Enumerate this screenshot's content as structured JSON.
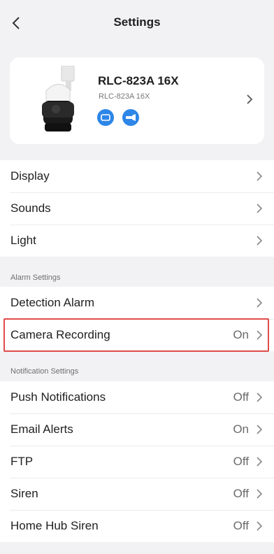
{
  "header": {
    "title": "Settings"
  },
  "device": {
    "name": "RLC-823A 16X",
    "model": "RLC-823A 16X",
    "badges": [
      "camera-badge-icon",
      "spotlight-badge-icon"
    ],
    "accent_color": "#2d86e8"
  },
  "general": {
    "items": [
      {
        "label": "Display",
        "value": ""
      },
      {
        "label": "Sounds",
        "value": ""
      },
      {
        "label": "Light",
        "value": ""
      }
    ]
  },
  "alarm": {
    "header": "Alarm Settings",
    "items": [
      {
        "label": "Detection Alarm",
        "value": ""
      },
      {
        "label": "Camera Recording",
        "value": "On"
      }
    ]
  },
  "notification": {
    "header": "Notification Settings",
    "items": [
      {
        "label": "Push Notifications",
        "value": "Off"
      },
      {
        "label": "Email Alerts",
        "value": "On"
      },
      {
        "label": "FTP",
        "value": "Off"
      },
      {
        "label": "Siren",
        "value": "Off"
      },
      {
        "label": "Home Hub Siren",
        "value": "Off"
      }
    ]
  },
  "highlight_color": "#e04b4b"
}
